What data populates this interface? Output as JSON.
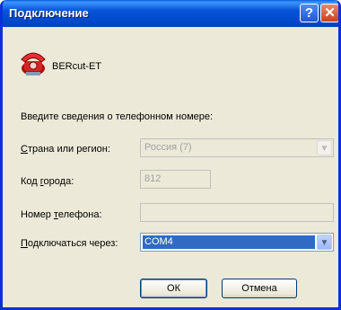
{
  "window": {
    "title": "Подключение"
  },
  "titlebar": {
    "help_glyph": "?",
    "close_glyph": "✕"
  },
  "app": {
    "name": "BERcut-ET"
  },
  "form": {
    "intro": "Введите сведения о телефонном номере:",
    "country": {
      "label_u": "С",
      "label_rest": "трана или регион:",
      "value": "Россия (7)"
    },
    "area": {
      "label_a": "Код ",
      "label_u": "г",
      "label_rest": "орода:",
      "value": "812"
    },
    "phone": {
      "label_a": "Номер ",
      "label_u": "т",
      "label_rest": "елефона:",
      "value": ""
    },
    "connect": {
      "label_u": "П",
      "label_rest": "одключаться через:",
      "value": "COM4"
    }
  },
  "buttons": {
    "ok": "ОК",
    "cancel": "Отмена"
  },
  "colors": {
    "title_bar": "#0653d7",
    "selection": "#316ac5",
    "dialog_bg": "#ece9d8"
  }
}
